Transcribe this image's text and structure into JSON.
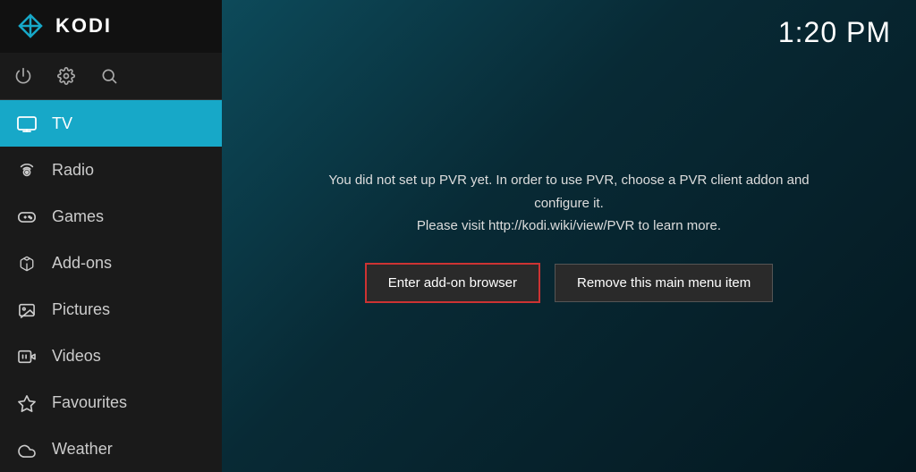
{
  "app": {
    "title": "KODI",
    "clock": "1:20 PM"
  },
  "toolbar": {
    "power_icon": "⏻",
    "settings_icon": "⚙",
    "search_icon": "🔍"
  },
  "nav": {
    "items": [
      {
        "id": "tv",
        "label": "TV",
        "icon": "tv",
        "active": true
      },
      {
        "id": "radio",
        "label": "Radio",
        "icon": "radio",
        "active": false
      },
      {
        "id": "games",
        "label": "Games",
        "icon": "games",
        "active": false
      },
      {
        "id": "addons",
        "label": "Add-ons",
        "icon": "addons",
        "active": false
      },
      {
        "id": "pictures",
        "label": "Pictures",
        "icon": "pictures",
        "active": false
      },
      {
        "id": "videos",
        "label": "Videos",
        "icon": "videos",
        "active": false
      },
      {
        "id": "favourites",
        "label": "Favourites",
        "icon": "favourites",
        "active": false
      },
      {
        "id": "weather",
        "label": "Weather",
        "icon": "weather",
        "active": false
      }
    ]
  },
  "main": {
    "pvr_message_line1": "You did not set up PVR yet. In order to use PVR, choose a PVR client addon and configure it.",
    "pvr_message_line2": "Please visit http://kodi.wiki/view/PVR to learn more.",
    "btn_addon_browser": "Enter add-on browser",
    "btn_remove_menu": "Remove this main menu item"
  }
}
